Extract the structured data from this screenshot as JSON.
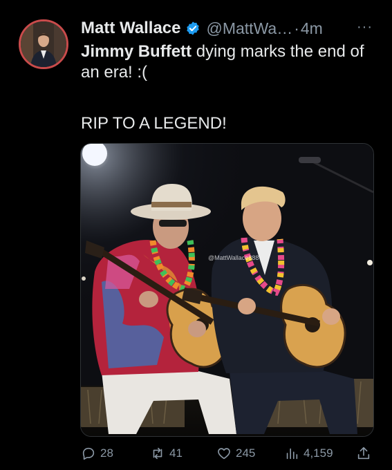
{
  "tweet": {
    "author_name": "Matt Wallace",
    "handle": "@MattWa…",
    "separator": "·",
    "time": "4m",
    "more_label": "···",
    "text_bold": "Jimmy Buffett",
    "text_rest": " dying marks the end of an era! :(",
    "text_line2": "RIP TO A LEGEND!",
    "watermark": "@MattWallace888"
  },
  "actions": {
    "replies": "28",
    "retweets": "41",
    "likes": "245",
    "views": "4,159"
  },
  "icons": {
    "verified": "verified-badge-icon",
    "reply": "reply-icon",
    "retweet": "retweet-icon",
    "like": "heart-icon",
    "views": "views-chart-icon",
    "share": "share-icon"
  },
  "colors": {
    "background": "#000000",
    "text": "#e7e9ea",
    "muted": "#8b98a5",
    "verified": "#1d9bf0",
    "avatar_ring": "#c94b4b"
  }
}
